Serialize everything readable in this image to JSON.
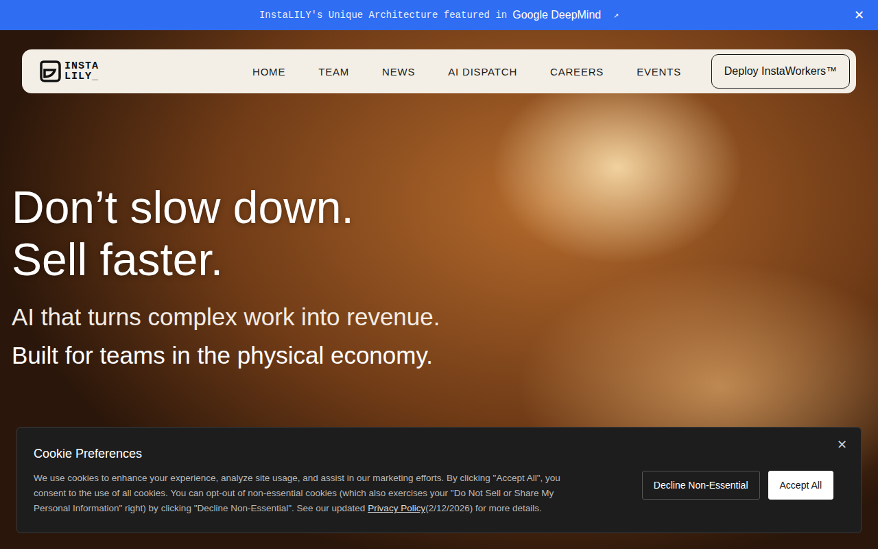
{
  "announcement": {
    "text": "InstaLILY's Unique Architecture featured in",
    "brand": "Google DeepMind",
    "arrow": "↗",
    "close": "✕"
  },
  "nav": {
    "logo": [
      "INSTA",
      "LILY_"
    ],
    "items": [
      "HOME",
      "TEAM",
      "NEWS",
      "AI DISPATCH",
      "CAREERS",
      "EVENTS"
    ],
    "cta": "Deploy InstaWorkers™"
  },
  "hero": {
    "lines": [
      "Don’t slow down.",
      "Sell faster."
    ],
    "sub": [
      "AI that turns complex work into revenue.",
      "Built for teams in the physical economy."
    ]
  },
  "cookie": {
    "title": "Cookie Preferences",
    "text_before": "We use cookies to enhance your experience, analyze site usage, and assist in our marketing efforts. By clicking \"Accept All\", you consent to the use of all cookies. You can opt-out of non-essential cookies (which also exercises your \"Do Not Sell or Share My Personal Information\" right) by clicking \"Decline Non-Essential\". See our updated ",
    "link": "Privacy Policy",
    "text_after": "(2/12/2026) for more details.",
    "decline": "Decline Non-Essential",
    "accept": "Accept All",
    "close": "✕"
  }
}
